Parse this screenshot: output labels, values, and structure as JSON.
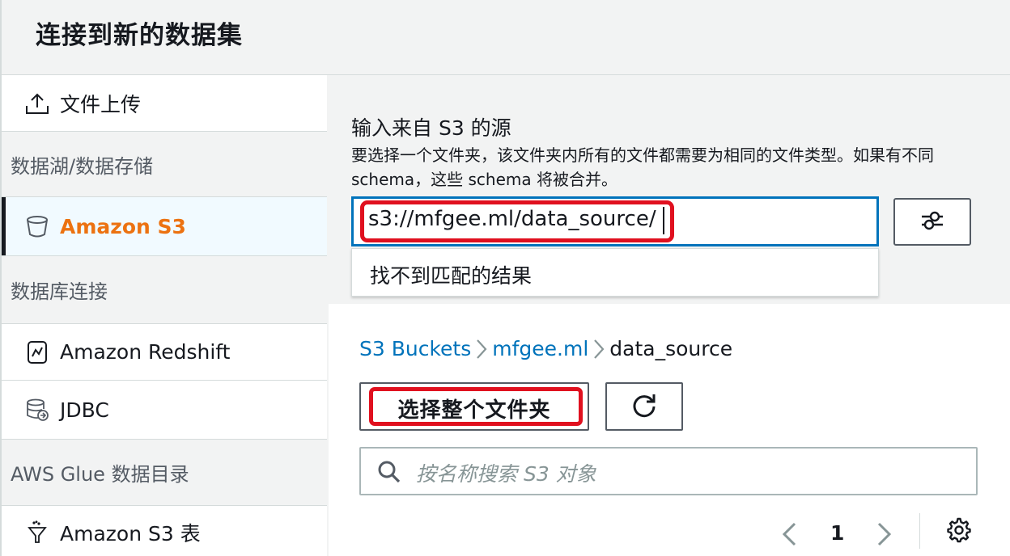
{
  "header": {
    "title": "连接到新的数据集"
  },
  "sidebar": {
    "upload": {
      "label": "文件上传",
      "icon": "upload-icon"
    },
    "group_datalake": "数据湖/数据存储",
    "s3": {
      "label": "Amazon S3",
      "icon": "bucket-icon"
    },
    "group_db": "数据库连接",
    "redshift": {
      "label": "Amazon Redshift",
      "icon": "redshift-icon"
    },
    "jdbc": {
      "label": "JDBC",
      "icon": "database-icon"
    },
    "group_glue": "AWS Glue 数据目录",
    "s3_tables": {
      "label": "Amazon S3 表",
      "icon": "funnel-icon"
    }
  },
  "source": {
    "title": "输入来自 S3 的源",
    "description": "要选择一个文件夹，该文件夹内所有的文件都需要为相同的文件类型。如果有不同 schema，这些 schema 将被合并。",
    "input_value": "s3://mfgee.ml/data_source/",
    "no_match": "找不到匹配的结果"
  },
  "breadcrumb": {
    "root": "S3 Buckets",
    "bucket": "mfgee.ml",
    "folder": "data_source"
  },
  "actions": {
    "select_folder": "选择整个文件夹"
  },
  "search": {
    "placeholder": "按名称搜索 S3 对象"
  },
  "pagination": {
    "current_page": "1"
  },
  "colors": {
    "accent": "#0073bb",
    "active": "#ec7211",
    "highlight": "#e0101f"
  }
}
